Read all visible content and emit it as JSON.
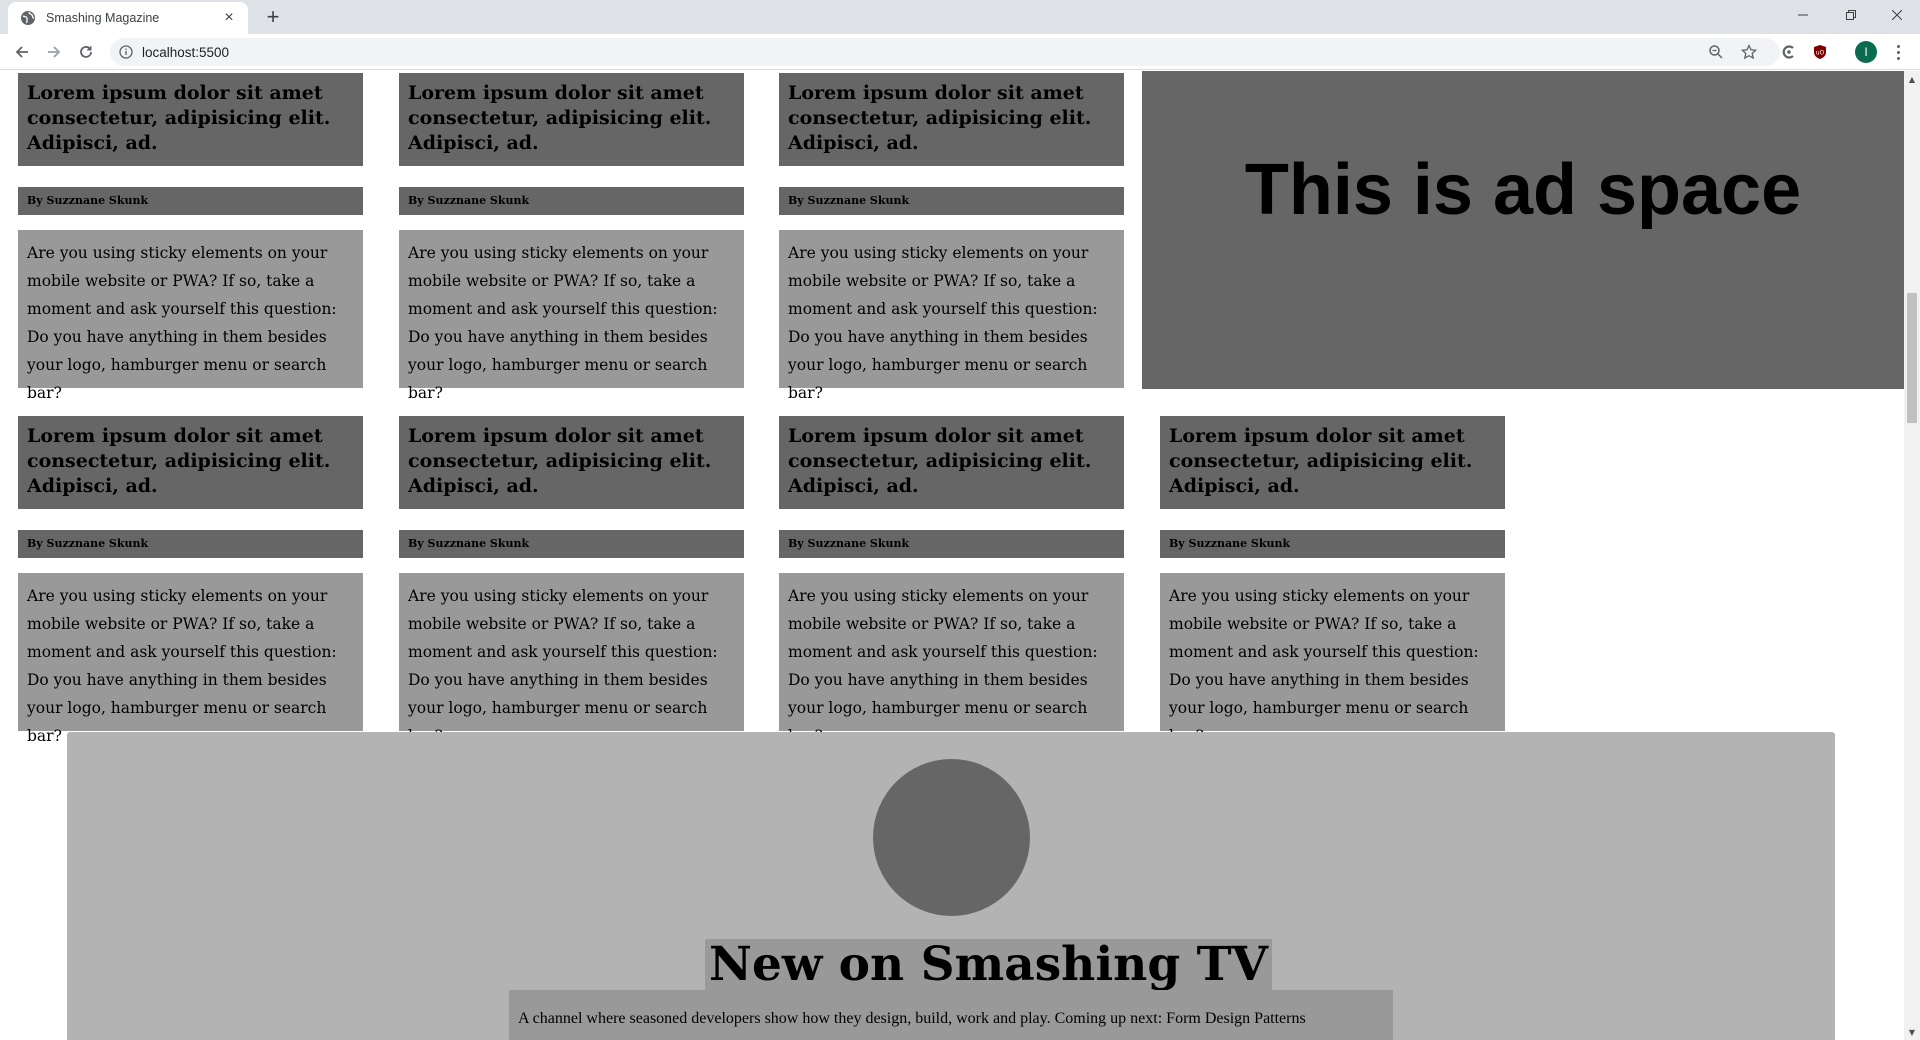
{
  "browser": {
    "tab_title": "Smashing Magazine",
    "tab_close": "×",
    "new_tab": "+",
    "url": "localhost:5500",
    "profile_initial": "I",
    "window_controls": {
      "minimize": "—",
      "restore": "❐",
      "close": "✕"
    }
  },
  "articles": {
    "row1": [
      {
        "title": "Lorem ipsum dolor sit amet consectetur, adipisicing elit. Adipisci, ad.",
        "byline": "By Suzznane Skunk",
        "body": "Are you using sticky elements on your mobile website or PWA? If so, take a moment and ask yourself this question: Do you have anything in them besides your logo, hamburger menu or search bar?"
      },
      {
        "title": "Lorem ipsum dolor sit amet consectetur, adipisicing elit. Adipisci, ad.",
        "byline": "By Suzznane Skunk",
        "body": "Are you using sticky elements on your mobile website or PWA? If so, take a moment and ask yourself this question: Do you have anything in them besides your logo, hamburger menu or search bar?"
      },
      {
        "title": "Lorem ipsum dolor sit amet consectetur, adipisicing elit. Adipisci, ad.",
        "byline": "By Suzznane Skunk",
        "body": "Are you using sticky elements on your mobile website or PWA? If so, take a moment and ask yourself this question: Do you have anything in them besides your logo, hamburger menu or search bar?"
      }
    ],
    "row2": [
      {
        "title": "Lorem ipsum dolor sit amet consectetur, adipisicing elit. Adipisci, ad.",
        "byline": "By Suzznane Skunk",
        "body": "Are you using sticky elements on your mobile website or PWA? If so, take a moment and ask yourself this question: Do you have anything in them besides your logo, hamburger menu or search bar?"
      },
      {
        "title": "Lorem ipsum dolor sit amet consectetur, adipisicing elit. Adipisci, ad.",
        "byline": "By Suzznane Skunk",
        "body": "Are you using sticky elements on your mobile website or PWA? If so, take a moment and ask yourself this question: Do you have anything in them besides your logo, hamburger menu or search bar?"
      },
      {
        "title": "Lorem ipsum dolor sit amet consectetur, adipisicing elit. Adipisci, ad.",
        "byline": "By Suzznane Skunk",
        "body": "Are you using sticky elements on your mobile website or PWA? If so, take a moment and ask yourself this question: Do you have anything in them besides your logo, hamburger menu or search bar?"
      },
      {
        "title": "Lorem ipsum dolor sit amet consectetur, adipisicing elit. Adipisci, ad.",
        "byline": "By Suzznane Skunk",
        "body": "Are you using sticky elements on your mobile website or PWA? If so, take a moment and ask yourself this question: Do you have anything in them besides your logo, hamburger menu or search bar?"
      }
    ]
  },
  "ad": {
    "text": "This is ad space"
  },
  "smashing_tv": {
    "title": "New on Smashing TV",
    "description": "A channel where seasoned developers show how they design, build, work and play. Coming up next: Form Design Patterns"
  },
  "colors": {
    "card_title_bg": "#666666",
    "card_body_bg": "#999999",
    "tv_bg": "#b3b3b3"
  }
}
